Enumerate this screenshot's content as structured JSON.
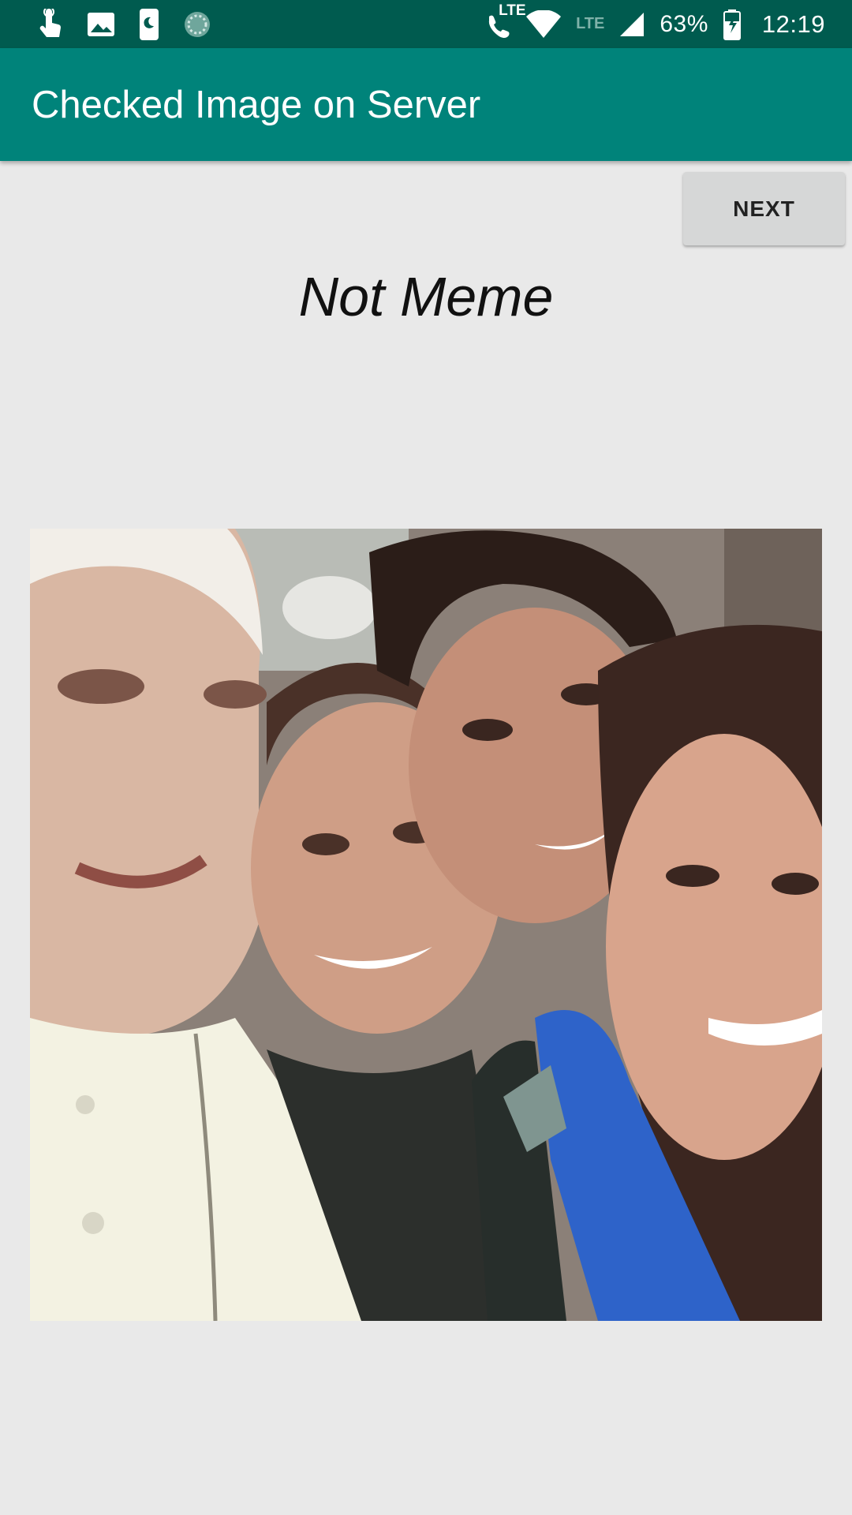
{
  "status_bar": {
    "icons": [
      "touch-icon",
      "gallery-icon",
      "phone-moon-icon",
      "sync-circle-icon",
      "volte-call-icon",
      "wifi-icon",
      "lte-icon",
      "signal-icon",
      "battery-charging-icon"
    ],
    "call_badge": "LTE",
    "network": "LTE",
    "battery": "63%",
    "time": "12:19"
  },
  "app_bar": {
    "title": "Checked Image on Server"
  },
  "actions": {
    "next_label": "NEXT"
  },
  "result": {
    "label": "Not Meme"
  },
  "photo": {
    "subject": "group-selfie-photo"
  }
}
